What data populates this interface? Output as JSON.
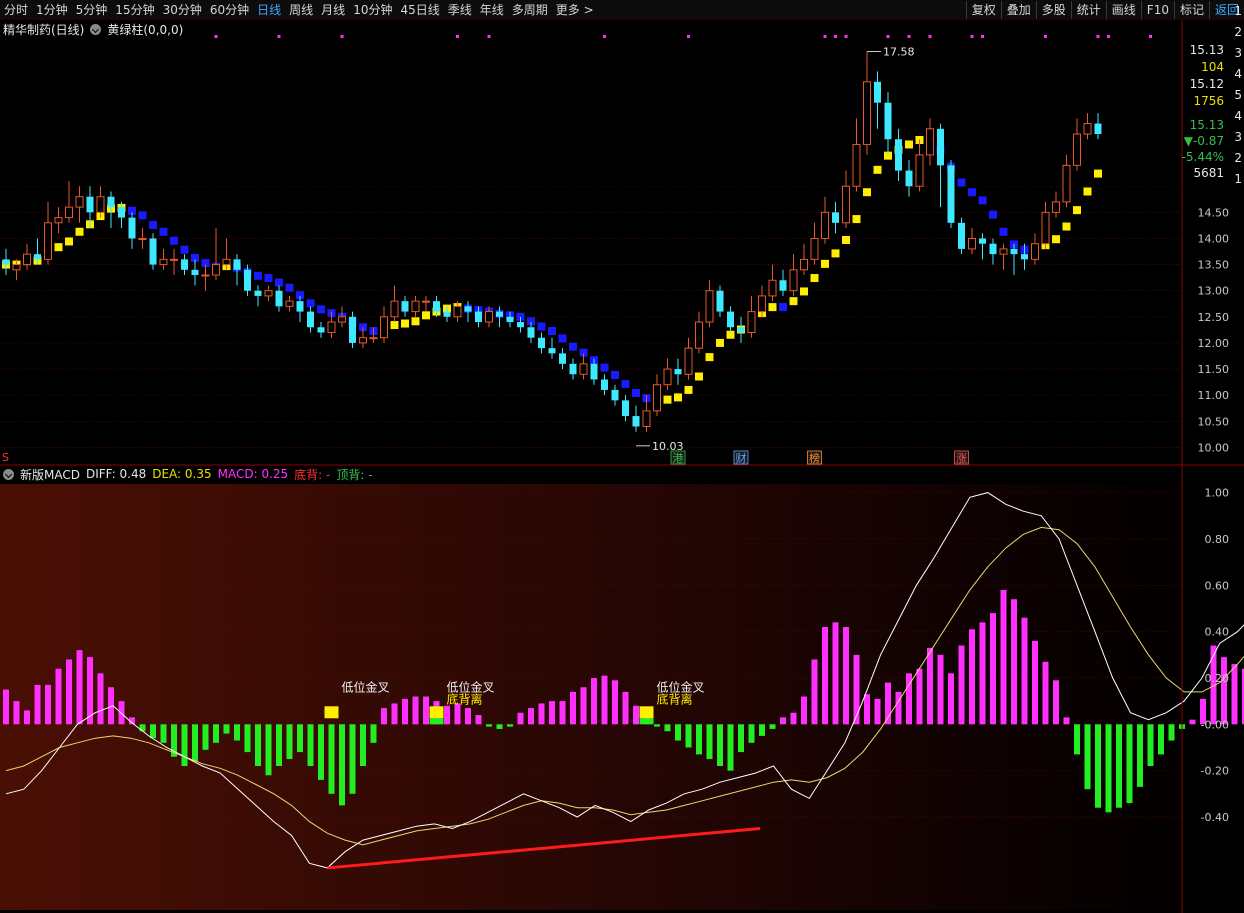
{
  "toolbar": {
    "periods": [
      "分时",
      "1分钟",
      "5分钟",
      "15分钟",
      "30分钟",
      "60分钟",
      "日线",
      "周线",
      "月线",
      "10分钟",
      "45日线",
      "季线",
      "年线",
      "多周期",
      "更多 >"
    ],
    "active_period": "日线",
    "tools": [
      "复权",
      "叠加",
      "多股",
      "统计",
      "画线",
      "F10",
      "标记",
      "返回"
    ]
  },
  "main_header": {
    "stock_title": "精华制药(日线)",
    "indicator_name": "黄绿柱(0,0,0)"
  },
  "sub_header": {
    "indicator_name": "新版MACD",
    "diff_label": "DIFF: 0.48",
    "dea_label": "DEA: 0.35",
    "macd_label": "MACD: 0.25",
    "bottom_div_label": "底背: -",
    "top_div_label": "顶背: -"
  },
  "main_chart": {
    "price_max_label": "17.58",
    "price_min_label": "10.03",
    "event_markers": [
      {
        "label": "港",
        "color": "#31c04a",
        "day": 64
      },
      {
        "label": "财",
        "color": "#5fa8ff",
        "day": 70
      },
      {
        "label": "榜",
        "color": "#ff8a28",
        "day": 77
      },
      {
        "label": "涨",
        "color": "#ff5050",
        "day": 91
      }
    ],
    "left_edge_marker": "S",
    "y_ticks": [
      "15.00",
      "14.50",
      "14.00",
      "13.50",
      "13.00",
      "12.50",
      "12.00",
      "11.50",
      "11.00",
      "10.50",
      "10.00"
    ]
  },
  "right_panel": {
    "quote": [
      {
        "text": "15.13",
        "color": "#e6e6e6"
      },
      {
        "text": "104",
        "color": "#e8e000"
      },
      {
        "text": "15.12",
        "color": "#e6e6e6"
      },
      {
        "text": "1756",
        "color": "#e8e000"
      },
      {
        "text": "15.13",
        "color": "#31c04a"
      },
      {
        "text": "▼-0.87",
        "color": "#31c04a"
      },
      {
        "text": "-5.44%",
        "color": "#31c04a"
      },
      {
        "text": "5681",
        "color": "#e6e6e6"
      }
    ],
    "order_book_digits": [
      "1",
      "2",
      "3",
      "4",
      "5",
      "4",
      "3",
      "2",
      "1"
    ]
  },
  "macd_panel": {
    "y_ticks": [
      "1.00",
      "0.80",
      "0.60",
      "0.40",
      "0.20",
      "-0.00",
      "-0.20",
      "-0.40"
    ],
    "annotations": [
      {
        "label": "低位金叉",
        "sub": "",
        "day": 31
      },
      {
        "label": "低位金叉",
        "sub": "底背离",
        "day": 41
      },
      {
        "label": "低位金叉",
        "sub": "底背离",
        "day": 61
      }
    ]
  },
  "colors": {
    "up_candle": "#e55a2a",
    "down_candle": "#3ee8ff",
    "yellow_trend": "#ffee00",
    "blue_trend": "#1a1aff",
    "macd_positive": "#ff30ff",
    "macd_negative": "#22ee22",
    "diff_line": "#ffffff",
    "dea_line": "#e8d870",
    "divergence_line": "#ff1a1a",
    "grid_red": "#7a0000",
    "signal_dot": "#ff30ff"
  },
  "candles": [
    [
      13.6,
      13.5,
      13.8,
      13.3
    ],
    [
      13.4,
      13.5,
      13.6,
      13.2
    ],
    [
      13.5,
      13.7,
      13.9,
      13.4
    ],
    [
      13.7,
      13.6,
      14.0,
      13.5
    ],
    [
      13.6,
      14.3,
      14.7,
      13.5
    ],
    [
      14.3,
      14.4,
      14.6,
      14.1
    ],
    [
      14.4,
      14.6,
      15.1,
      14.3
    ],
    [
      14.6,
      14.8,
      15.0,
      14.3
    ],
    [
      14.8,
      14.5,
      15.0,
      14.2
    ],
    [
      14.5,
      14.8,
      15.0,
      14.4
    ],
    [
      14.8,
      14.6,
      14.9,
      14.2
    ],
    [
      14.6,
      14.4,
      14.7,
      14.2
    ],
    [
      14.4,
      14.0,
      14.5,
      13.8
    ],
    [
      14.0,
      14.0,
      14.2,
      13.8
    ],
    [
      14.0,
      13.5,
      14.1,
      13.4
    ],
    [
      13.5,
      13.6,
      13.8,
      13.4
    ],
    [
      13.6,
      13.6,
      13.8,
      13.3
    ],
    [
      13.6,
      13.4,
      13.7,
      13.3
    ],
    [
      13.4,
      13.3,
      13.6,
      13.1
    ],
    [
      13.3,
      13.3,
      13.5,
      13.0
    ],
    [
      13.3,
      13.5,
      14.2,
      13.2
    ],
    [
      13.5,
      13.6,
      14.0,
      13.4
    ],
    [
      13.6,
      13.4,
      13.7,
      13.1
    ],
    [
      13.4,
      13.0,
      13.5,
      12.9
    ],
    [
      13.0,
      12.9,
      13.1,
      12.7
    ],
    [
      12.9,
      13.0,
      13.1,
      12.8
    ],
    [
      13.0,
      12.7,
      13.1,
      12.6
    ],
    [
      12.7,
      12.8,
      12.9,
      12.6
    ],
    [
      12.8,
      12.6,
      12.9,
      12.4
    ],
    [
      12.6,
      12.3,
      12.7,
      12.2
    ],
    [
      12.3,
      12.2,
      12.4,
      12.1
    ],
    [
      12.2,
      12.4,
      12.6,
      12.1
    ],
    [
      12.4,
      12.5,
      12.7,
      12.3
    ],
    [
      12.5,
      12.0,
      12.6,
      11.9
    ],
    [
      12.0,
      12.1,
      12.3,
      11.9
    ],
    [
      12.1,
      12.1,
      12.3,
      12.0
    ],
    [
      12.1,
      12.5,
      12.7,
      12.0
    ],
    [
      12.5,
      12.8,
      13.1,
      12.4
    ],
    [
      12.8,
      12.6,
      12.9,
      12.5
    ],
    [
      12.6,
      12.8,
      12.9,
      12.5
    ],
    [
      12.8,
      12.8,
      12.9,
      12.6
    ],
    [
      12.8,
      12.6,
      12.9,
      12.5
    ],
    [
      12.6,
      12.5,
      12.7,
      12.4
    ],
    [
      12.5,
      12.7,
      12.8,
      12.4
    ],
    [
      12.7,
      12.6,
      12.8,
      12.4
    ],
    [
      12.6,
      12.4,
      12.7,
      12.3
    ],
    [
      12.4,
      12.6,
      12.7,
      12.3
    ],
    [
      12.6,
      12.5,
      12.7,
      12.3
    ],
    [
      12.5,
      12.4,
      12.6,
      12.3
    ],
    [
      12.4,
      12.3,
      12.5,
      12.2
    ],
    [
      12.3,
      12.1,
      12.4,
      12.0
    ],
    [
      12.1,
      11.9,
      12.2,
      11.8
    ],
    [
      11.9,
      11.8,
      12.1,
      11.7
    ],
    [
      11.8,
      11.6,
      11.9,
      11.5
    ],
    [
      11.6,
      11.4,
      11.7,
      11.3
    ],
    [
      11.4,
      11.6,
      11.8,
      11.3
    ],
    [
      11.6,
      11.3,
      11.7,
      11.2
    ],
    [
      11.3,
      11.1,
      11.4,
      11.0
    ],
    [
      11.1,
      10.9,
      11.2,
      10.8
    ],
    [
      10.9,
      10.6,
      11.0,
      10.5
    ],
    [
      10.6,
      10.4,
      10.8,
      10.3
    ],
    [
      10.4,
      10.7,
      11.0,
      10.3
    ],
    [
      10.7,
      11.2,
      11.4,
      10.6
    ],
    [
      11.2,
      11.5,
      11.7,
      11.1
    ],
    [
      11.5,
      11.4,
      11.7,
      11.2
    ],
    [
      11.4,
      11.9,
      12.1,
      11.3
    ],
    [
      11.9,
      12.4,
      12.6,
      11.8
    ],
    [
      12.4,
      13.0,
      13.2,
      12.3
    ],
    [
      13.0,
      12.6,
      13.1,
      12.5
    ],
    [
      12.6,
      12.3,
      12.7,
      12.2
    ],
    [
      12.3,
      12.2,
      12.5,
      12.0
    ],
    [
      12.2,
      12.6,
      12.9,
      12.1
    ],
    [
      12.6,
      12.9,
      13.1,
      12.5
    ],
    [
      12.9,
      13.2,
      13.5,
      12.8
    ],
    [
      13.2,
      13.0,
      13.4,
      12.9
    ],
    [
      13.0,
      13.4,
      13.7,
      12.9
    ],
    [
      13.4,
      13.6,
      13.9,
      13.3
    ],
    [
      13.6,
      14.0,
      14.3,
      13.5
    ],
    [
      14.0,
      14.5,
      14.8,
      13.9
    ],
    [
      14.5,
      14.3,
      14.7,
      14.1
    ],
    [
      14.3,
      15.0,
      15.3,
      14.2
    ],
    [
      15.0,
      15.8,
      16.3,
      14.9
    ],
    [
      15.8,
      17.0,
      17.58,
      15.6
    ],
    [
      17.0,
      16.6,
      17.2,
      16.1
    ],
    [
      16.6,
      15.9,
      16.8,
      15.6
    ],
    [
      15.9,
      15.3,
      16.1,
      15.1
    ],
    [
      15.3,
      15.0,
      15.5,
      14.8
    ],
    [
      15.0,
      15.6,
      15.9,
      14.9
    ],
    [
      15.6,
      16.1,
      16.3,
      15.4
    ],
    [
      16.1,
      15.4,
      16.2,
      14.6
    ],
    [
      15.4,
      14.3,
      15.5,
      14.2
    ],
    [
      14.3,
      13.8,
      14.4,
      13.7
    ],
    [
      13.8,
      14.0,
      14.2,
      13.7
    ],
    [
      14.0,
      13.9,
      14.1,
      13.6
    ],
    [
      13.9,
      13.7,
      14.0,
      13.5
    ],
    [
      13.7,
      13.8,
      13.9,
      13.4
    ],
    [
      13.8,
      13.7,
      13.9,
      13.3
    ],
    [
      13.7,
      13.6,
      13.9,
      13.4
    ],
    [
      13.6,
      13.9,
      14.1,
      13.5
    ],
    [
      13.9,
      14.5,
      14.7,
      13.8
    ],
    [
      14.5,
      14.7,
      14.9,
      14.4
    ],
    [
      14.7,
      15.4,
      15.6,
      14.6
    ],
    [
      15.4,
      16.0,
      16.3,
      15.3
    ],
    [
      16.0,
      16.2,
      16.4,
      15.9
    ],
    [
      16.2,
      16.0,
      16.4,
      15.9
    ]
  ],
  "macd_hist": [
    0.15,
    0.1,
    0.06,
    0.17,
    0.17,
    0.24,
    0.28,
    0.32,
    0.29,
    0.22,
    0.16,
    0.1,
    0.03,
    -0.03,
    -0.06,
    -0.08,
    -0.14,
    -0.18,
    -0.16,
    -0.11,
    -0.08,
    -0.04,
    -0.07,
    -0.12,
    -0.18,
    -0.22,
    -0.18,
    -0.15,
    -0.12,
    -0.18,
    -0.24,
    -0.3,
    -0.35,
    -0.3,
    -0.18,
    -0.08,
    0.07,
    0.09,
    0.11,
    0.12,
    0.12,
    0.1,
    0.08,
    0.09,
    0.07,
    0.04,
    -0.01,
    -0.02,
    -0.01,
    0.05,
    0.07,
    0.09,
    0.1,
    0.1,
    0.14,
    0.16,
    0.2,
    0.21,
    0.19,
    0.14,
    0.08,
    0.03,
    -0.01,
    -0.03,
    -0.07,
    -0.1,
    -0.13,
    -0.15,
    -0.18,
    -0.2,
    -0.12,
    -0.08,
    -0.05,
    -0.02,
    0.03,
    0.05,
    0.12,
    0.28,
    0.42,
    0.44,
    0.42,
    0.3,
    0.13,
    0.11,
    0.18,
    0.14,
    0.22,
    0.24,
    0.33,
    0.3,
    0.22,
    0.34,
    0.41,
    0.44,
    0.48,
    0.58,
    0.54,
    0.46,
    0.36,
    0.27,
    0.19,
    0.03,
    -0.13,
    -0.28,
    -0.36,
    -0.38,
    -0.36,
    -0.34,
    -0.27,
    -0.18,
    -0.13,
    -0.07,
    -0.02,
    0.02,
    0.11,
    0.34,
    0.29,
    0.26,
    0.24,
    0.17
  ],
  "diff_line": [
    -0.3,
    -0.28,
    -0.2,
    -0.1,
    0.0,
    0.05,
    0.08,
    0.01,
    -0.05,
    -0.1,
    -0.14,
    -0.18,
    -0.21,
    -0.28,
    -0.35,
    -0.42,
    -0.48,
    -0.6,
    -0.62,
    -0.55,
    -0.5,
    -0.48,
    -0.46,
    -0.44,
    -0.43,
    -0.45,
    -0.42,
    -0.38,
    -0.34,
    -0.3,
    -0.33,
    -0.36,
    -0.4,
    -0.35,
    -0.38,
    -0.42,
    -0.37,
    -0.34,
    -0.3,
    -0.28,
    -0.25,
    -0.23,
    -0.21,
    -0.18,
    -0.28,
    -0.32,
    -0.2,
    -0.08,
    0.1,
    0.3,
    0.45,
    0.6,
    0.72,
    0.85,
    0.98,
    1.0,
    0.95,
    0.92,
    0.9,
    0.8,
    0.6,
    0.4,
    0.2,
    0.05,
    0.02,
    0.05,
    0.1,
    0.2,
    0.35,
    0.4,
    0.48
  ],
  "dea_line": [
    -0.2,
    -0.18,
    -0.14,
    -0.1,
    -0.08,
    -0.06,
    -0.05,
    -0.06,
    -0.08,
    -0.11,
    -0.14,
    -0.17,
    -0.19,
    -0.22,
    -0.26,
    -0.3,
    -0.35,
    -0.42,
    -0.47,
    -0.5,
    -0.52,
    -0.5,
    -0.48,
    -0.46,
    -0.45,
    -0.44,
    -0.43,
    -0.41,
    -0.38,
    -0.35,
    -0.33,
    -0.34,
    -0.36,
    -0.36,
    -0.37,
    -0.39,
    -0.38,
    -0.37,
    -0.35,
    -0.33,
    -0.31,
    -0.29,
    -0.27,
    -0.25,
    -0.24,
    -0.25,
    -0.23,
    -0.19,
    -0.12,
    -0.02,
    0.1,
    0.22,
    0.34,
    0.46,
    0.58,
    0.68,
    0.76,
    0.82,
    0.85,
    0.84,
    0.78,
    0.68,
    0.55,
    0.42,
    0.3,
    0.2,
    0.14,
    0.14,
    0.18,
    0.26,
    0.35
  ]
}
